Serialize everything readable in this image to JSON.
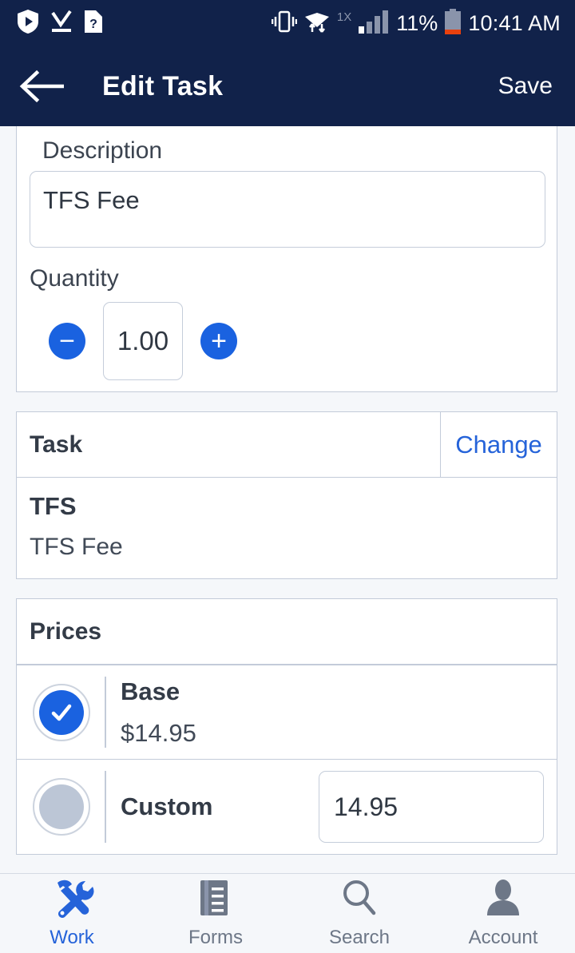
{
  "statusbar": {
    "icons_left": [
      "play-protect-shield-icon",
      "download-complete-icon",
      "unknown-file-icon"
    ],
    "icons_right": [
      "vibrate-icon",
      "wifi-transfer-icon",
      "signal-bars-icon"
    ],
    "network_type": "1X",
    "battery_percent": "11%",
    "time": "10:41 AM"
  },
  "appbar": {
    "back_icon": "back-arrow-icon",
    "title": "Edit Task",
    "save_label": "Save"
  },
  "form": {
    "description_label": "Description",
    "description_value": "TFS Fee",
    "quantity_label": "Quantity",
    "quantity_value": "1.00",
    "decrement_label": "−",
    "increment_label": "+"
  },
  "task_card": {
    "header": "Task",
    "change_label": "Change",
    "code": "TFS",
    "description": "TFS Fee"
  },
  "prices_card": {
    "header": "Prices",
    "rows": [
      {
        "name": "Base",
        "value": "$14.95",
        "selected": true
      },
      {
        "name": "Custom",
        "value": "14.95",
        "selected": false
      }
    ]
  },
  "bottom_nav": [
    {
      "label": "Work",
      "icon": "tools-icon",
      "active": true
    },
    {
      "label": "Forms",
      "icon": "document-lines-icon",
      "active": false
    },
    {
      "label": "Search",
      "icon": "magnifier-icon",
      "active": false
    },
    {
      "label": "Account",
      "icon": "person-icon",
      "active": false
    }
  ],
  "colors": {
    "appbar_bg": "#11224a",
    "accent_blue": "#1a62e0",
    "link_blue": "#2563d9",
    "page_bg": "#f5f7fa",
    "border": "#c3cbd9"
  }
}
